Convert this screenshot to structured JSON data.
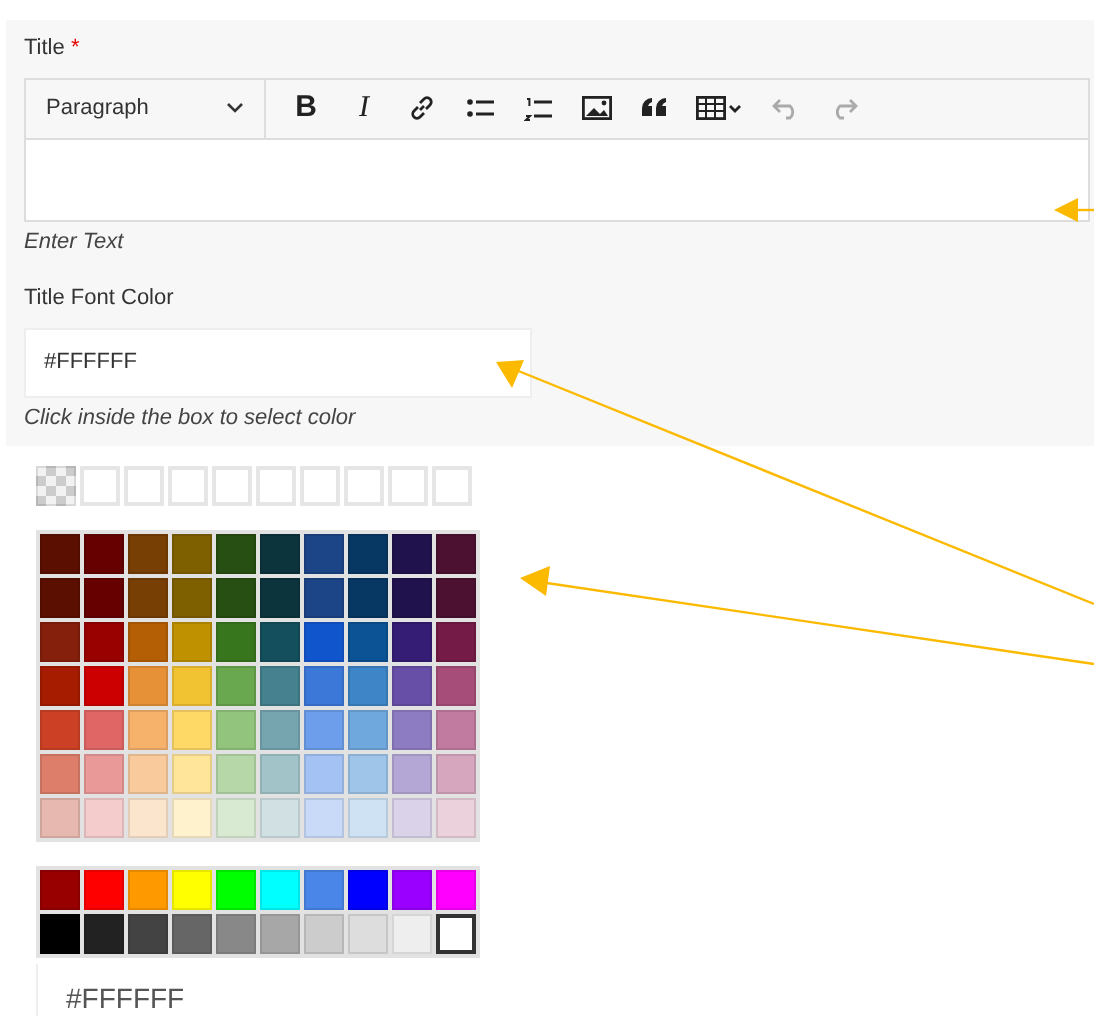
{
  "title_field": {
    "label": "Title",
    "required_mark": "*",
    "block_format": "Paragraph",
    "toolbar": [
      {
        "kind": "bold",
        "label": "B",
        "disabled": false
      },
      {
        "kind": "italic",
        "label": "I",
        "disabled": false
      },
      {
        "kind": "link",
        "disabled": false
      },
      {
        "kind": "bullets",
        "disabled": false
      },
      {
        "kind": "numbers",
        "disabled": false
      },
      {
        "kind": "image",
        "disabled": false
      },
      {
        "kind": "quote",
        "disabled": false
      },
      {
        "kind": "table",
        "disabled": false
      },
      {
        "kind": "undo",
        "disabled": true
      },
      {
        "kind": "redo",
        "disabled": true
      }
    ],
    "hint": "Enter Text"
  },
  "font_color_field": {
    "label": "Title Font Color",
    "value": "#FFFFFF",
    "hint": "Click inside the box to select color"
  },
  "color_picker": {
    "custom_swatches": [
      {
        "kind": "transparent"
      },
      {
        "kind": "empty"
      },
      {
        "kind": "empty"
      },
      {
        "kind": "empty"
      },
      {
        "kind": "empty"
      },
      {
        "kind": "empty"
      },
      {
        "kind": "empty"
      },
      {
        "kind": "empty"
      },
      {
        "kind": "empty"
      },
      {
        "kind": "empty"
      }
    ],
    "palette_rows": [
      [
        {
          "color": "#5b0f00",
          "selected": false
        },
        {
          "color": "#660000",
          "selected": false
        },
        {
          "color": "#783f04",
          "selected": false
        },
        {
          "color": "#7f6000",
          "selected": false
        },
        {
          "color": "#274e13",
          "selected": false
        },
        {
          "color": "#0c343d",
          "selected": false
        },
        {
          "color": "#1c4587",
          "selected": false
        },
        {
          "color": "#073763",
          "selected": false
        },
        {
          "color": "#20124d",
          "selected": false
        },
        {
          "color": "#4c1130",
          "selected": false
        }
      ],
      [
        {
          "color": "#5b0f00",
          "selected": false
        },
        {
          "color": "#660000",
          "selected": false
        },
        {
          "color": "#783f04",
          "selected": false
        },
        {
          "color": "#7f6000",
          "selected": false
        },
        {
          "color": "#274e13",
          "selected": false
        },
        {
          "color": "#0c343d",
          "selected": false
        },
        {
          "color": "#1c4587",
          "selected": false
        },
        {
          "color": "#073763",
          "selected": false
        },
        {
          "color": "#20124d",
          "selected": false
        },
        {
          "color": "#4c1130",
          "selected": false
        }
      ],
      [
        {
          "color": "#85200c",
          "selected": false
        },
        {
          "color": "#990000",
          "selected": false
        },
        {
          "color": "#b45f06",
          "selected": false
        },
        {
          "color": "#bf9000",
          "selected": false
        },
        {
          "color": "#38761d",
          "selected": false
        },
        {
          "color": "#134f5c",
          "selected": false
        },
        {
          "color": "#1155cc",
          "selected": false
        },
        {
          "color": "#0b5394",
          "selected": false
        },
        {
          "color": "#351c75",
          "selected": false
        },
        {
          "color": "#741b47",
          "selected": false
        }
      ],
      [
        {
          "color": "#a61c00",
          "selected": false
        },
        {
          "color": "#cc0000",
          "selected": false
        },
        {
          "color": "#e69138",
          "selected": false
        },
        {
          "color": "#f1c232",
          "selected": false
        },
        {
          "color": "#6aa84f",
          "selected": false
        },
        {
          "color": "#45818e",
          "selected": false
        },
        {
          "color": "#3c78d8",
          "selected": false
        },
        {
          "color": "#3d85c6",
          "selected": false
        },
        {
          "color": "#674ea7",
          "selected": false
        },
        {
          "color": "#a64d79",
          "selected": false
        }
      ],
      [
        {
          "color": "#cc4125",
          "selected": false
        },
        {
          "color": "#e06666",
          "selected": false
        },
        {
          "color": "#f6b26b",
          "selected": false
        },
        {
          "color": "#ffd966",
          "selected": false
        },
        {
          "color": "#93c47d",
          "selected": false
        },
        {
          "color": "#76a5af",
          "selected": false
        },
        {
          "color": "#6d9eeb",
          "selected": false
        },
        {
          "color": "#6fa8dc",
          "selected": false
        },
        {
          "color": "#8e7cc3",
          "selected": false
        },
        {
          "color": "#c27ba0",
          "selected": false
        }
      ],
      [
        {
          "color": "#dd7e6b",
          "selected": false
        },
        {
          "color": "#ea9999",
          "selected": false
        },
        {
          "color": "#f9cb9c",
          "selected": false
        },
        {
          "color": "#ffe599",
          "selected": false
        },
        {
          "color": "#b6d7a8",
          "selected": false
        },
        {
          "color": "#a2c4c9",
          "selected": false
        },
        {
          "color": "#a4c2f4",
          "selected": false
        },
        {
          "color": "#9fc5e8",
          "selected": false
        },
        {
          "color": "#b4a7d6",
          "selected": false
        },
        {
          "color": "#d5a6bd",
          "selected": false
        }
      ],
      [
        {
          "color": "#e6b8af",
          "selected": false
        },
        {
          "color": "#f4cccc",
          "selected": false
        },
        {
          "color": "#fce5cd",
          "selected": false
        },
        {
          "color": "#fff2cc",
          "selected": false
        },
        {
          "color": "#d9ead3",
          "selected": false
        },
        {
          "color": "#d0e0e3",
          "selected": false
        },
        {
          "color": "#c9daf8",
          "selected": false
        },
        {
          "color": "#cfe2f3",
          "selected": false
        },
        {
          "color": "#d9d2e9",
          "selected": false
        },
        {
          "color": "#ead1dc",
          "selected": false
        }
      ]
    ],
    "basic_rows": [
      [
        {
          "color": "#980000",
          "selected": false
        },
        {
          "color": "#ff0000",
          "selected": false
        },
        {
          "color": "#ff9900",
          "selected": false
        },
        {
          "color": "#ffff00",
          "selected": false
        },
        {
          "color": "#00ff00",
          "selected": false
        },
        {
          "color": "#00ffff",
          "selected": false
        },
        {
          "color": "#4a86e8",
          "selected": false
        },
        {
          "color": "#0000ff",
          "selected": false
        },
        {
          "color": "#9900ff",
          "selected": false
        },
        {
          "color": "#ff00ff",
          "selected": false
        }
      ],
      [
        {
          "color": "#000000",
          "selected": false
        },
        {
          "color": "#222222",
          "selected": false
        },
        {
          "color": "#434343",
          "selected": false
        },
        {
          "color": "#666666",
          "selected": false
        },
        {
          "color": "#888888",
          "selected": false
        },
        {
          "color": "#a7a7a7",
          "selected": false
        },
        {
          "color": "#cccccc",
          "selected": false
        },
        {
          "color": "#dddddd",
          "selected": false
        },
        {
          "color": "#eeeeee",
          "selected": false
        },
        {
          "color": "#ffffff",
          "selected": true
        }
      ]
    ],
    "hex_value": "#FFFFFF"
  }
}
